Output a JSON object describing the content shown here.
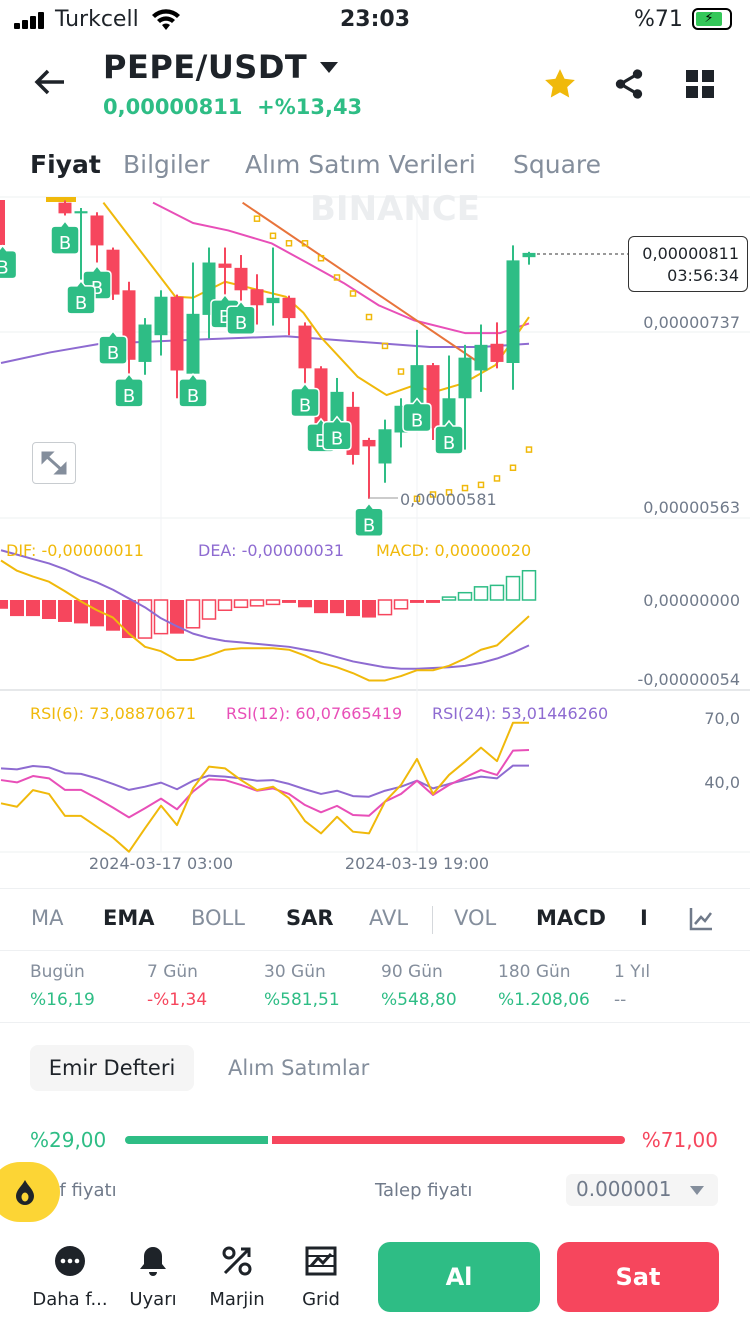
{
  "status": {
    "carrier": "Turkcell",
    "time": "23:03",
    "battery": "%71"
  },
  "header": {
    "pair": "PEPE/USDT",
    "price": "0,00000811",
    "change": "+%13,43"
  },
  "tabs": [
    "Fiyat",
    "Bilgiler",
    "Alım Satım Verileri",
    "Square"
  ],
  "colors": {
    "green": "#2ebd85",
    "red": "#f6465d",
    "yellow": "#f0b90b",
    "pink": "#e84fb8",
    "purple": "#8e6bd1",
    "orange": "#e8743b"
  },
  "chart": {
    "watermark": "BINANCE",
    "last_price": "0,00000811",
    "countdown": "03:56:34",
    "axis_labels": [
      "0,00000737",
      "0,00000563"
    ],
    "low_label": "0,00000581",
    "macd_legend": {
      "dif": "DIF: -0,00000011",
      "dea": "DEA: -0,00000031",
      "macd": "MACD: 0,00000020"
    },
    "macd_axis": [
      "0,00000000",
      "-0,00000054"
    ],
    "rsi_legend": {
      "r6": "RSI(6): 73,08870671",
      "r12": "RSI(12): 60,07665419",
      "r24": "RSI(24): 53,01446260"
    },
    "rsi_axis": [
      "70,0",
      "40,0"
    ],
    "dates": [
      "2024-03-17 03:00",
      "2024-03-19 19:00"
    ]
  },
  "chart_data": {
    "type": "candlestick",
    "price_unit": "1e-8 USDT",
    "candles": [
      [
        4,
        8.58,
        8.48,
        8.6,
        8.46
      ],
      [
        5,
        8.48,
        8.5,
        8.53,
        7.86
      ],
      [
        6,
        8.46,
        8.18,
        8.49,
        8.02
      ],
      [
        7,
        8.14,
        7.72,
        8.16,
        7.67
      ],
      [
        8,
        7.76,
        7.11,
        7.84,
        6.87
      ],
      [
        9,
        7.09,
        7.44,
        7.5,
        6.97
      ],
      [
        10,
        7.34,
        7.7,
        7.76,
        7.15
      ],
      [
        11,
        7.7,
        7.01,
        7.72,
        6.75
      ],
      [
        12,
        6.98,
        7.54,
        8.02,
        6.9
      ],
      [
        13,
        7.53,
        8.02,
        8.16,
        7.31
      ],
      [
        14,
        8.01,
        7.97,
        8.16,
        7.44
      ],
      [
        15,
        7.97,
        7.76,
        8.09,
        7.44
      ],
      [
        16,
        7.77,
        7.62,
        7.91,
        7.44
      ],
      [
        17,
        7.64,
        7.69,
        8.16,
        7.43
      ],
      [
        18,
        7.69,
        7.5,
        7.71,
        7.34
      ],
      [
        19,
        7.43,
        7.03,
        7.46,
        6.81
      ],
      [
        20,
        7.03,
        6.51,
        7.05,
        6.45
      ],
      [
        21,
        6.52,
        6.81,
        6.94,
        6.45
      ],
      [
        22,
        6.67,
        6.22,
        6.81,
        6.13
      ],
      [
        23,
        6.36,
        6.3,
        6.38,
        5.81
      ],
      [
        24,
        6.14,
        6.46,
        6.55,
        5.96
      ],
      [
        25,
        6.43,
        6.68,
        6.75,
        6.29
      ],
      [
        26,
        6.69,
        7.06,
        7.39,
        6.55
      ],
      [
        27,
        7.06,
        6.47,
        7.08,
        6.36
      ],
      [
        28,
        6.43,
        6.75,
        7.15,
        6.43
      ],
      [
        29,
        6.75,
        7.13,
        7.25,
        6.27
      ],
      [
        30,
        7.01,
        7.25,
        7.44,
        6.81
      ],
      [
        31,
        7.26,
        7.09,
        7.46,
        7.03
      ],
      [
        32,
        7.08,
        8.04,
        8.18,
        6.83
      ],
      [
        33,
        8.07,
        8.11,
        8.12,
        8.0
      ]
    ],
    "ema7": [
      [
        6.4,
        8.58
      ],
      [
        10.9,
        7.7
      ],
      [
        12,
        7.69
      ],
      [
        14,
        7.84
      ],
      [
        17.8,
        7.7
      ],
      [
        18.9,
        7.55
      ],
      [
        20,
        7.32
      ],
      [
        22.3,
        6.95
      ],
      [
        24.1,
        6.78
      ],
      [
        25.8,
        6.87
      ],
      [
        27.1,
        6.81
      ],
      [
        28.9,
        6.89
      ],
      [
        30.9,
        7.06
      ],
      [
        33,
        7.51
      ]
    ],
    "ema25": [
      [
        9.5,
        8.58
      ],
      [
        12,
        8.39
      ],
      [
        14.2,
        8.32
      ],
      [
        16.9,
        8.2
      ],
      [
        19.1,
        8.02
      ],
      [
        21.4,
        7.83
      ],
      [
        23.6,
        7.62
      ],
      [
        25.8,
        7.48
      ],
      [
        29,
        7.36
      ],
      [
        31.2,
        7.36
      ],
      [
        33,
        7.45
      ]
    ],
    "ema99": [
      [
        0,
        7.08
      ],
      [
        3.1,
        7.18
      ],
      [
        6.2,
        7.26
      ],
      [
        12.4,
        7.3
      ],
      [
        17.8,
        7.33
      ],
      [
        22.3,
        7.28
      ],
      [
        26.8,
        7.23
      ],
      [
        30,
        7.23
      ],
      [
        33,
        7.26
      ]
    ],
    "trendline": [
      [
        15.1,
        8.58
      ],
      [
        30.1,
        7.06
      ]
    ],
    "sar": [
      [
        16,
        8.43
      ],
      [
        17,
        8.27
      ],
      [
        18,
        8.2
      ],
      [
        19,
        8.2
      ],
      [
        20,
        8.06
      ],
      [
        21,
        7.88
      ],
      [
        22,
        7.73
      ],
      [
        23,
        7.51
      ],
      [
        24,
        7.24
      ],
      [
        25,
        7.0
      ],
      [
        26,
        5.81
      ],
      [
        27,
        5.85
      ],
      [
        28,
        5.87
      ],
      [
        29,
        5.91
      ],
      [
        30,
        5.94
      ],
      [
        31,
        6.0
      ],
      [
        32,
        6.1
      ],
      [
        33,
        6.27
      ]
    ],
    "buy_markers": [
      [
        0.1,
        8.0
      ],
      [
        4,
        8.23
      ],
      [
        6,
        7.81
      ],
      [
        5,
        7.67
      ],
      [
        7,
        7.2
      ],
      [
        8,
        6.8
      ],
      [
        12,
        6.8
      ],
      [
        14,
        7.54
      ],
      [
        15,
        7.48
      ],
      [
        19,
        6.71
      ],
      [
        20,
        6.38
      ],
      [
        21,
        6.4
      ],
      [
        23,
        5.59
      ],
      [
        26,
        6.57
      ],
      [
        28,
        6.36
      ]
    ],
    "marker_label": "B",
    "macd_hist": [
      -0.06,
      -0.11,
      -0.11,
      -0.13,
      -0.15,
      -0.16,
      -0.18,
      -0.21,
      -0.26,
      -0.26,
      -0.23,
      -0.23,
      -0.19,
      -0.13,
      -0.07,
      -0.05,
      -0.04,
      -0.03,
      -0.02,
      -0.05,
      -0.09,
      -0.09,
      -0.11,
      -0.12,
      -0.1,
      -0.06,
      -0.02,
      -0.02,
      0.02,
      0.05,
      0.09,
      0.1,
      0.16,
      0.2
    ],
    "macd_hollow": [
      0,
      0,
      0,
      0,
      0,
      0,
      0,
      0,
      0,
      1,
      1,
      0,
      1,
      1,
      1,
      1,
      1,
      1,
      0,
      0,
      0,
      0,
      0,
      0,
      1,
      1,
      0,
      0,
      1,
      1,
      1,
      1,
      1,
      1
    ],
    "dif": [
      0.27,
      0.2,
      0.16,
      0.125,
      0.06,
      -0.01,
      -0.07,
      -0.12,
      -0.23,
      -0.32,
      -0.35,
      -0.41,
      -0.41,
      -0.38,
      -0.34,
      -0.33,
      -0.33,
      -0.33,
      -0.34,
      -0.38,
      -0.43,
      -0.46,
      -0.5,
      -0.55,
      -0.55,
      -0.52,
      -0.48,
      -0.48,
      -0.45,
      -0.4,
      -0.34,
      -0.31,
      -0.21,
      -0.11
    ],
    "dea": [
      0.34,
      0.31,
      0.28,
      0.25,
      0.21,
      0.16,
      0.12,
      0.07,
      0.01,
      -0.05,
      -0.125,
      -0.18,
      -0.23,
      -0.26,
      -0.28,
      -0.29,
      -0.3,
      -0.31,
      -0.32,
      -0.34,
      -0.36,
      -0.39,
      -0.42,
      -0.44,
      -0.46,
      -0.47,
      -0.47,
      -0.465,
      -0.46,
      -0.45,
      -0.43,
      -0.4,
      -0.36,
      -0.31
    ],
    "rsi6": [
      30.0,
      28.4,
      36.2,
      34.4,
      24.1,
      24.1,
      19.0,
      13.9,
      7.3,
      18.3,
      28.9,
      19.8,
      37.0,
      47.2,
      46.4,
      40.9,
      36.2,
      37.8,
      32.4,
      21.7,
      15.9,
      23.7,
      16.7,
      15.9,
      30.8,
      38.6,
      50.8,
      34.4,
      43.3,
      49.5,
      56.1,
      49.8,
      67.8,
      67.8
    ],
    "rsi12": [
      40.9,
      39.8,
      42.8,
      41.7,
      36.3,
      36.3,
      32.3,
      28.0,
      23.4,
      27.7,
      32.2,
      27.2,
      35.5,
      41.3,
      40.9,
      38.6,
      35.9,
      37.0,
      34.4,
      29.2,
      25.8,
      28.8,
      24.5,
      24.2,
      30.8,
      34.4,
      40.6,
      33.9,
      38.6,
      42.2,
      45.6,
      43.3,
      54.7,
      55.0
    ],
    "rsi24": [
      46.4,
      45.9,
      47.5,
      46.9,
      44.1,
      43.8,
      41.7,
      39.1,
      36.3,
      37.8,
      39.7,
      36.6,
      40.6,
      43.0,
      42.5,
      41.7,
      40.6,
      40.9,
      39.1,
      36.6,
      34.4,
      35.9,
      33.4,
      33.1,
      35.9,
      37.8,
      40.6,
      37.0,
      39.1,
      40.9,
      42.5,
      41.7,
      47.7,
      47.7
    ]
  },
  "indicators": [
    "MA",
    "EMA",
    "BOLL",
    "SAR",
    "AVL",
    "VOL",
    "MACD",
    "I"
  ],
  "stats": [
    {
      "label": "Bugün",
      "value": "%16,19",
      "dir": "up"
    },
    {
      "label": "7 Gün",
      "value": "-%1,34",
      "dir": "down"
    },
    {
      "label": "30 Gün",
      "value": "%581,51",
      "dir": "up"
    },
    {
      "label": "90 Gün",
      "value": "%548,80",
      "dir": "up"
    },
    {
      "label": "180 Gün",
      "value": "%1.208,06",
      "dir": "up"
    },
    {
      "label": "1 Yıl",
      "value": "--",
      "dir": "none"
    }
  ],
  "orderbook": {
    "tabs": [
      "Emir Defteri",
      "Alım Satımlar"
    ],
    "buy_pct": "%29,00",
    "sell_pct": "%71,00",
    "buy_ratio": 0.29,
    "bid_label": "Teklif fiyatı",
    "ask_label": "Talep fiyatı",
    "precision": "0.000001"
  },
  "bottom": {
    "nav": [
      "Daha f...",
      "Uyarı",
      "Marjin",
      "Grid"
    ],
    "buy": "Al",
    "sell": "Sat"
  }
}
